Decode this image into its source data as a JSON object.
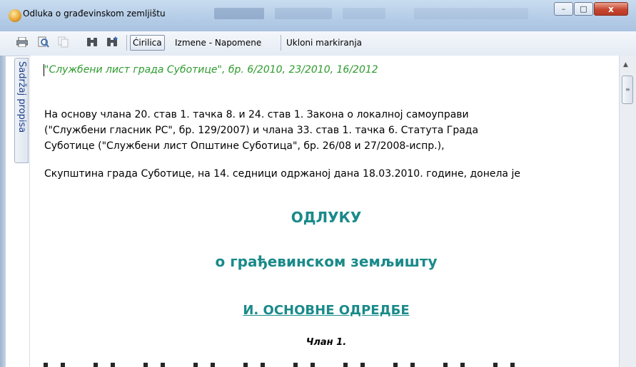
{
  "window": {
    "title": "Odluka o građevinskom zemljištu",
    "app_icon": "app-globe-icon",
    "controls": {
      "minimize": "–",
      "maximize": "□",
      "close": "x"
    }
  },
  "toolbar": {
    "icons": [
      "print-icon",
      "print-preview-icon",
      "copy-icon",
      "binoculars-icon",
      "binoculars-next-icon"
    ],
    "cirilica_label": "Ćirilica",
    "izmene_label": "Izmene - Napomene",
    "ukloni_label": "Ukloni markiranja"
  },
  "side_tab": {
    "label": "Sadržaj propisa"
  },
  "document": {
    "gazette": "\"Службени лист града Суботице\", бр. 6/2010, 23/2010, 16/2012",
    "preamble_lines": [
      "На основу члана 20. став 1. тачка 8. и 24. став 1. Закона о локалној самоуправи",
      "(\"Службени гласник РС\", бр. 129/2007) и члана 33. став 1. тачка 6. Статута Града",
      "Суботице (\"Службени лист Општине Суботица\", бр. 26/08 и 27/2008-испр.),"
    ],
    "assembly": "Скупштина града Суботице, на 14. седници одржаној дана 18.03.2010. године, донела је",
    "decision_title": "ОДЛУКУ",
    "decision_subtitle": "о грађевинском земљишту",
    "chapter": "И. ОСНОВНЕ ОДРЕДБЕ",
    "article": "Члан 1."
  },
  "colors": {
    "gazette_green": "#2e9b2e",
    "heading_teal": "#1a8a8a",
    "titlebar": "#b4cce6"
  }
}
